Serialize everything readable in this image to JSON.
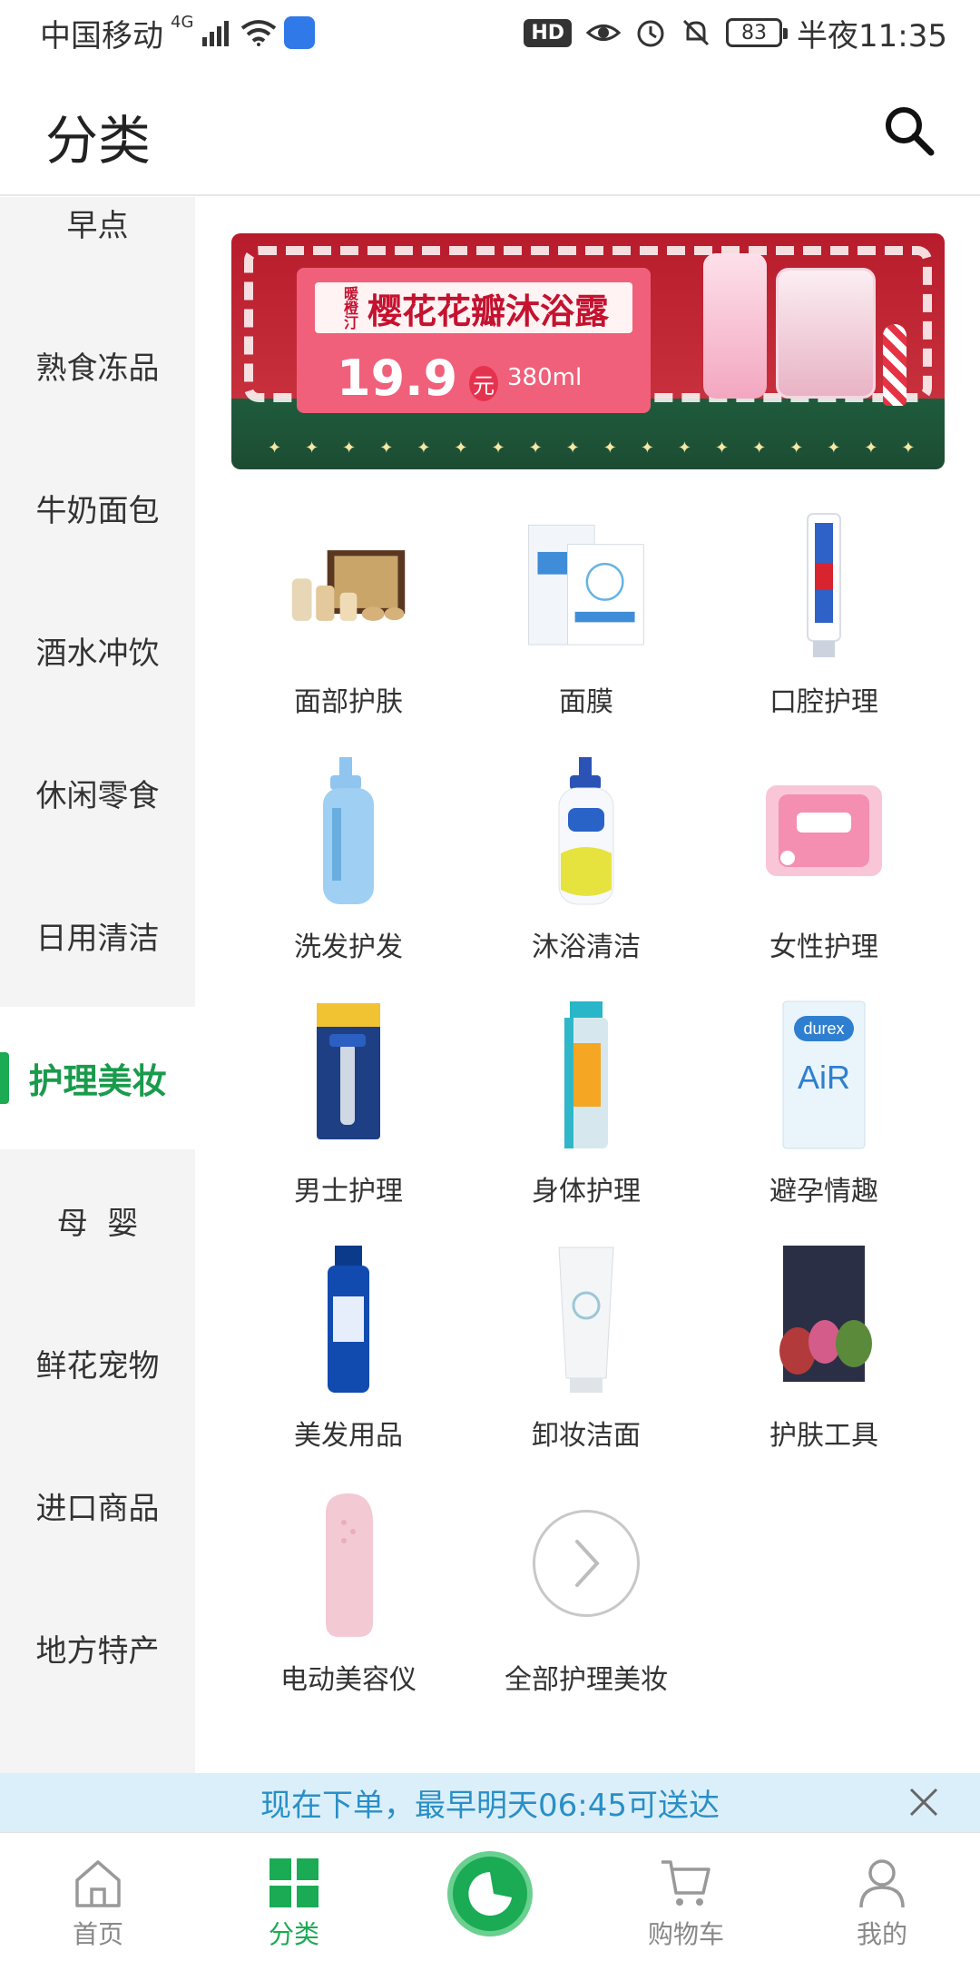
{
  "status_bar": {
    "carrier": "中国移动",
    "network": "4G",
    "battery": "83",
    "time": "半夜11:35",
    "hd": "HD"
  },
  "header": {
    "title": "分类"
  },
  "sidebar": {
    "items": [
      {
        "label": "早点"
      },
      {
        "label": "熟食冻品"
      },
      {
        "label": "牛奶面包"
      },
      {
        "label": "酒水冲饮"
      },
      {
        "label": "休闲零食"
      },
      {
        "label": "日用清洁"
      },
      {
        "label": "护理美妆"
      },
      {
        "label": "母  婴"
      },
      {
        "label": "鲜花宠物"
      },
      {
        "label": "进口商品"
      },
      {
        "label": "地方特产"
      }
    ],
    "active_index": 6,
    "accent_color": "#1aab54"
  },
  "banner": {
    "brand": "暖橙汀",
    "title": "樱花花瓣沐浴露",
    "price": "19.9",
    "unit": "元",
    "volume": "380ml"
  },
  "categories": [
    {
      "label": "面部护肤",
      "icon": "skincare-set-icon"
    },
    {
      "label": "面膜",
      "icon": "face-mask-icon"
    },
    {
      "label": "口腔护理",
      "icon": "toothpaste-icon"
    },
    {
      "label": "洗发护发",
      "icon": "shampoo-icon"
    },
    {
      "label": "沐浴清洁",
      "icon": "body-wash-icon"
    },
    {
      "label": "女性护理",
      "icon": "sanitary-pad-icon"
    },
    {
      "label": "男士护理",
      "icon": "razor-icon"
    },
    {
      "label": "身体护理",
      "icon": "spray-icon"
    },
    {
      "label": "避孕情趣",
      "icon": "condom-box-icon"
    },
    {
      "label": "美发用品",
      "icon": "hair-spray-icon"
    },
    {
      "label": "卸妆洁面",
      "icon": "cleanser-tube-icon"
    },
    {
      "label": "护肤工具",
      "icon": "beauty-sponge-icon"
    },
    {
      "label": "电动美容仪",
      "icon": "face-brush-icon"
    },
    {
      "label": "全部护理美妆",
      "icon": "chevron-right-icon"
    }
  ],
  "notice": {
    "text": "现在下单，最早明天06:45可送达"
  },
  "bottom_nav": {
    "items": [
      {
        "label": "首页",
        "icon": "home-icon"
      },
      {
        "label": "分类",
        "icon": "grid-icon"
      },
      {
        "label": "",
        "icon": "brand-icon"
      },
      {
        "label": "购物车",
        "icon": "cart-icon"
      },
      {
        "label": "我的",
        "icon": "user-icon"
      }
    ],
    "active_index": 1
  }
}
